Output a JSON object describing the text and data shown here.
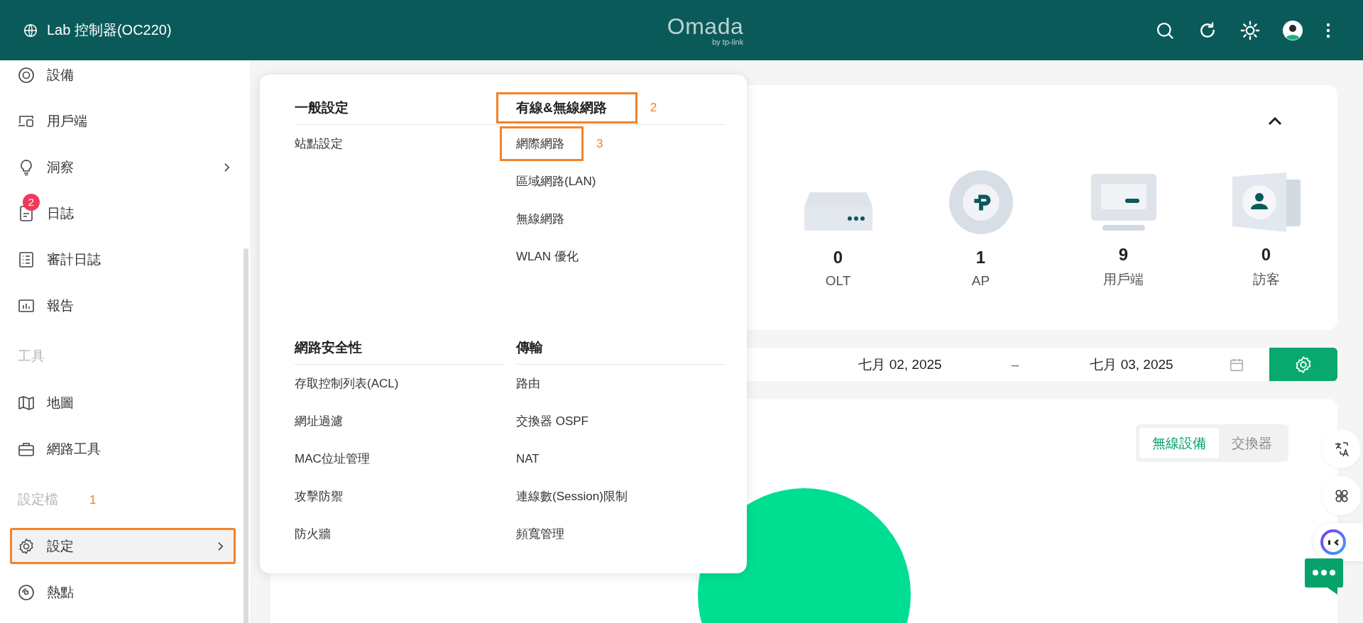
{
  "header": {
    "site": "Lab 控制器(OC220)",
    "logo": "Omada",
    "logo_sub": "by tp-link"
  },
  "sidebar": {
    "sections": [
      {
        "items": [
          {
            "label": "設備",
            "submenu": false,
            "selected": false
          },
          {
            "label": "用戶端",
            "submenu": false,
            "selected": false
          },
          {
            "label": "洞察",
            "submenu": true,
            "selected": false
          },
          {
            "label": "日誌",
            "submenu": false,
            "selected": false,
            "badge": "2"
          },
          {
            "label": "審計日誌",
            "submenu": false,
            "selected": false
          },
          {
            "label": "報告",
            "submenu": false,
            "selected": false
          }
        ]
      },
      {
        "title": "工具",
        "items": [
          {
            "label": "地圖",
            "submenu": false,
            "selected": false
          },
          {
            "label": "網路工具",
            "submenu": false,
            "selected": false
          }
        ]
      },
      {
        "title": "設定檔",
        "annotation": "1",
        "items": [
          {
            "label": "設定",
            "submenu": true,
            "selected": true,
            "highlighted": true
          },
          {
            "label": "熱點",
            "submenu": false,
            "selected": false
          }
        ]
      }
    ]
  },
  "settings_menu": {
    "sections": [
      {
        "title": "一般設定",
        "items": [
          {
            "label": "站點設定"
          }
        ]
      },
      {
        "title": "有線&無線網路",
        "highlighted": true,
        "annotation": "2",
        "items": [
          {
            "label": "網際網路",
            "highlighted": true,
            "annotation": "3"
          },
          {
            "label": "區域網路(LAN)"
          },
          {
            "label": "無線網路"
          },
          {
            "label": "WLAN 優化"
          }
        ]
      },
      {
        "title": "網路安全性",
        "items": [
          {
            "label": "存取控制列表(ACL)"
          },
          {
            "label": "網址過濾"
          },
          {
            "label": "MAC位址管理"
          },
          {
            "label": "攻擊防禦"
          },
          {
            "label": "防火牆"
          }
        ]
      },
      {
        "title": "傳輸",
        "items": [
          {
            "label": "路由"
          },
          {
            "label": "交換器 OSPF"
          },
          {
            "label": "NAT"
          },
          {
            "label": "連線數(Session)限制"
          },
          {
            "label": "頻寬管理"
          }
        ]
      }
    ]
  },
  "stats": [
    {
      "value": "0",
      "label": "OLT"
    },
    {
      "value": "1",
      "label": "AP"
    },
    {
      "value": "9",
      "label": "用戶端"
    },
    {
      "value": "0",
      "label": "訪客"
    }
  ],
  "date_range": {
    "start": "七月 02, 2025",
    "separator": "–",
    "end": "七月 03, 2025"
  },
  "device_tabs": [
    {
      "label": "無線設備",
      "selected": true
    },
    {
      "label": "交換器",
      "selected": false
    }
  ]
}
